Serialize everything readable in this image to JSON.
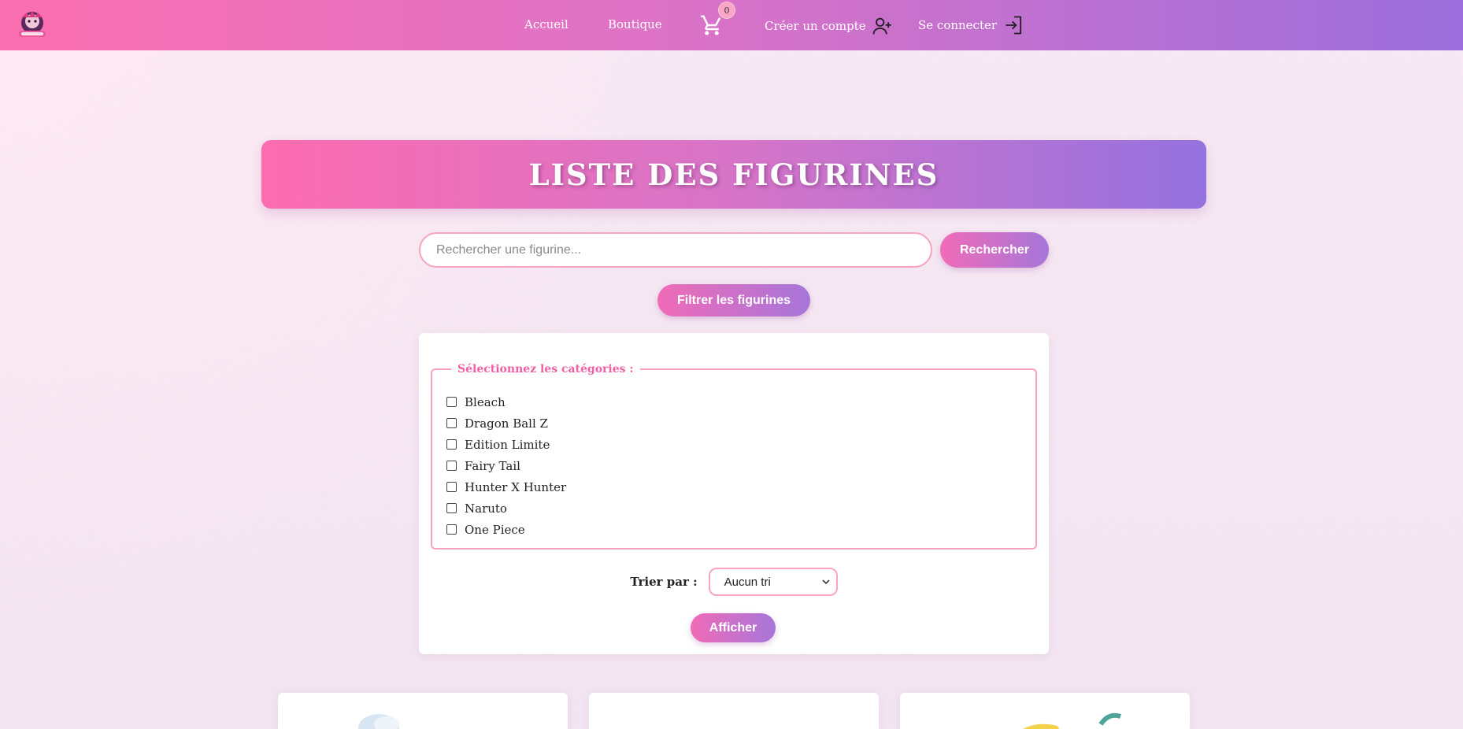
{
  "header": {
    "nav": [
      {
        "label": "Accueil"
      },
      {
        "label": "Boutique"
      }
    ],
    "cart_count": "0",
    "register_label": "Créer un compte",
    "login_label": "Se connecter"
  },
  "banner": {
    "title": "LISTE DES FIGURINES"
  },
  "search": {
    "placeholder": "Rechercher une figurine...",
    "value": "",
    "button_label": "Rechercher"
  },
  "filter_button_label": "Filtrer les figurines",
  "filter_panel": {
    "legend": "Sélectionnez les catégories :",
    "categories": [
      {
        "label": "Bleach",
        "checked": false
      },
      {
        "label": "Dragon Ball Z",
        "checked": false
      },
      {
        "label": "Edition Limite",
        "checked": false
      },
      {
        "label": "Fairy Tail",
        "checked": false
      },
      {
        "label": "Hunter X Hunter",
        "checked": false
      },
      {
        "label": "Naruto",
        "checked": false
      },
      {
        "label": "One Piece",
        "checked": false
      }
    ],
    "sort_label": "Trier par :",
    "sort_selected": "Aucun tri",
    "submit_label": "Afficher"
  },
  "colors": {
    "primary_pink": "#fb6fb0",
    "primary_purple": "#9572df",
    "border_pink": "#f9a4c1",
    "legend_pink": "#f05ea6"
  },
  "icons": {
    "cart": "cart-icon",
    "register": "user-plus-icon",
    "login": "login-icon",
    "select": "chevron-down-icon"
  }
}
